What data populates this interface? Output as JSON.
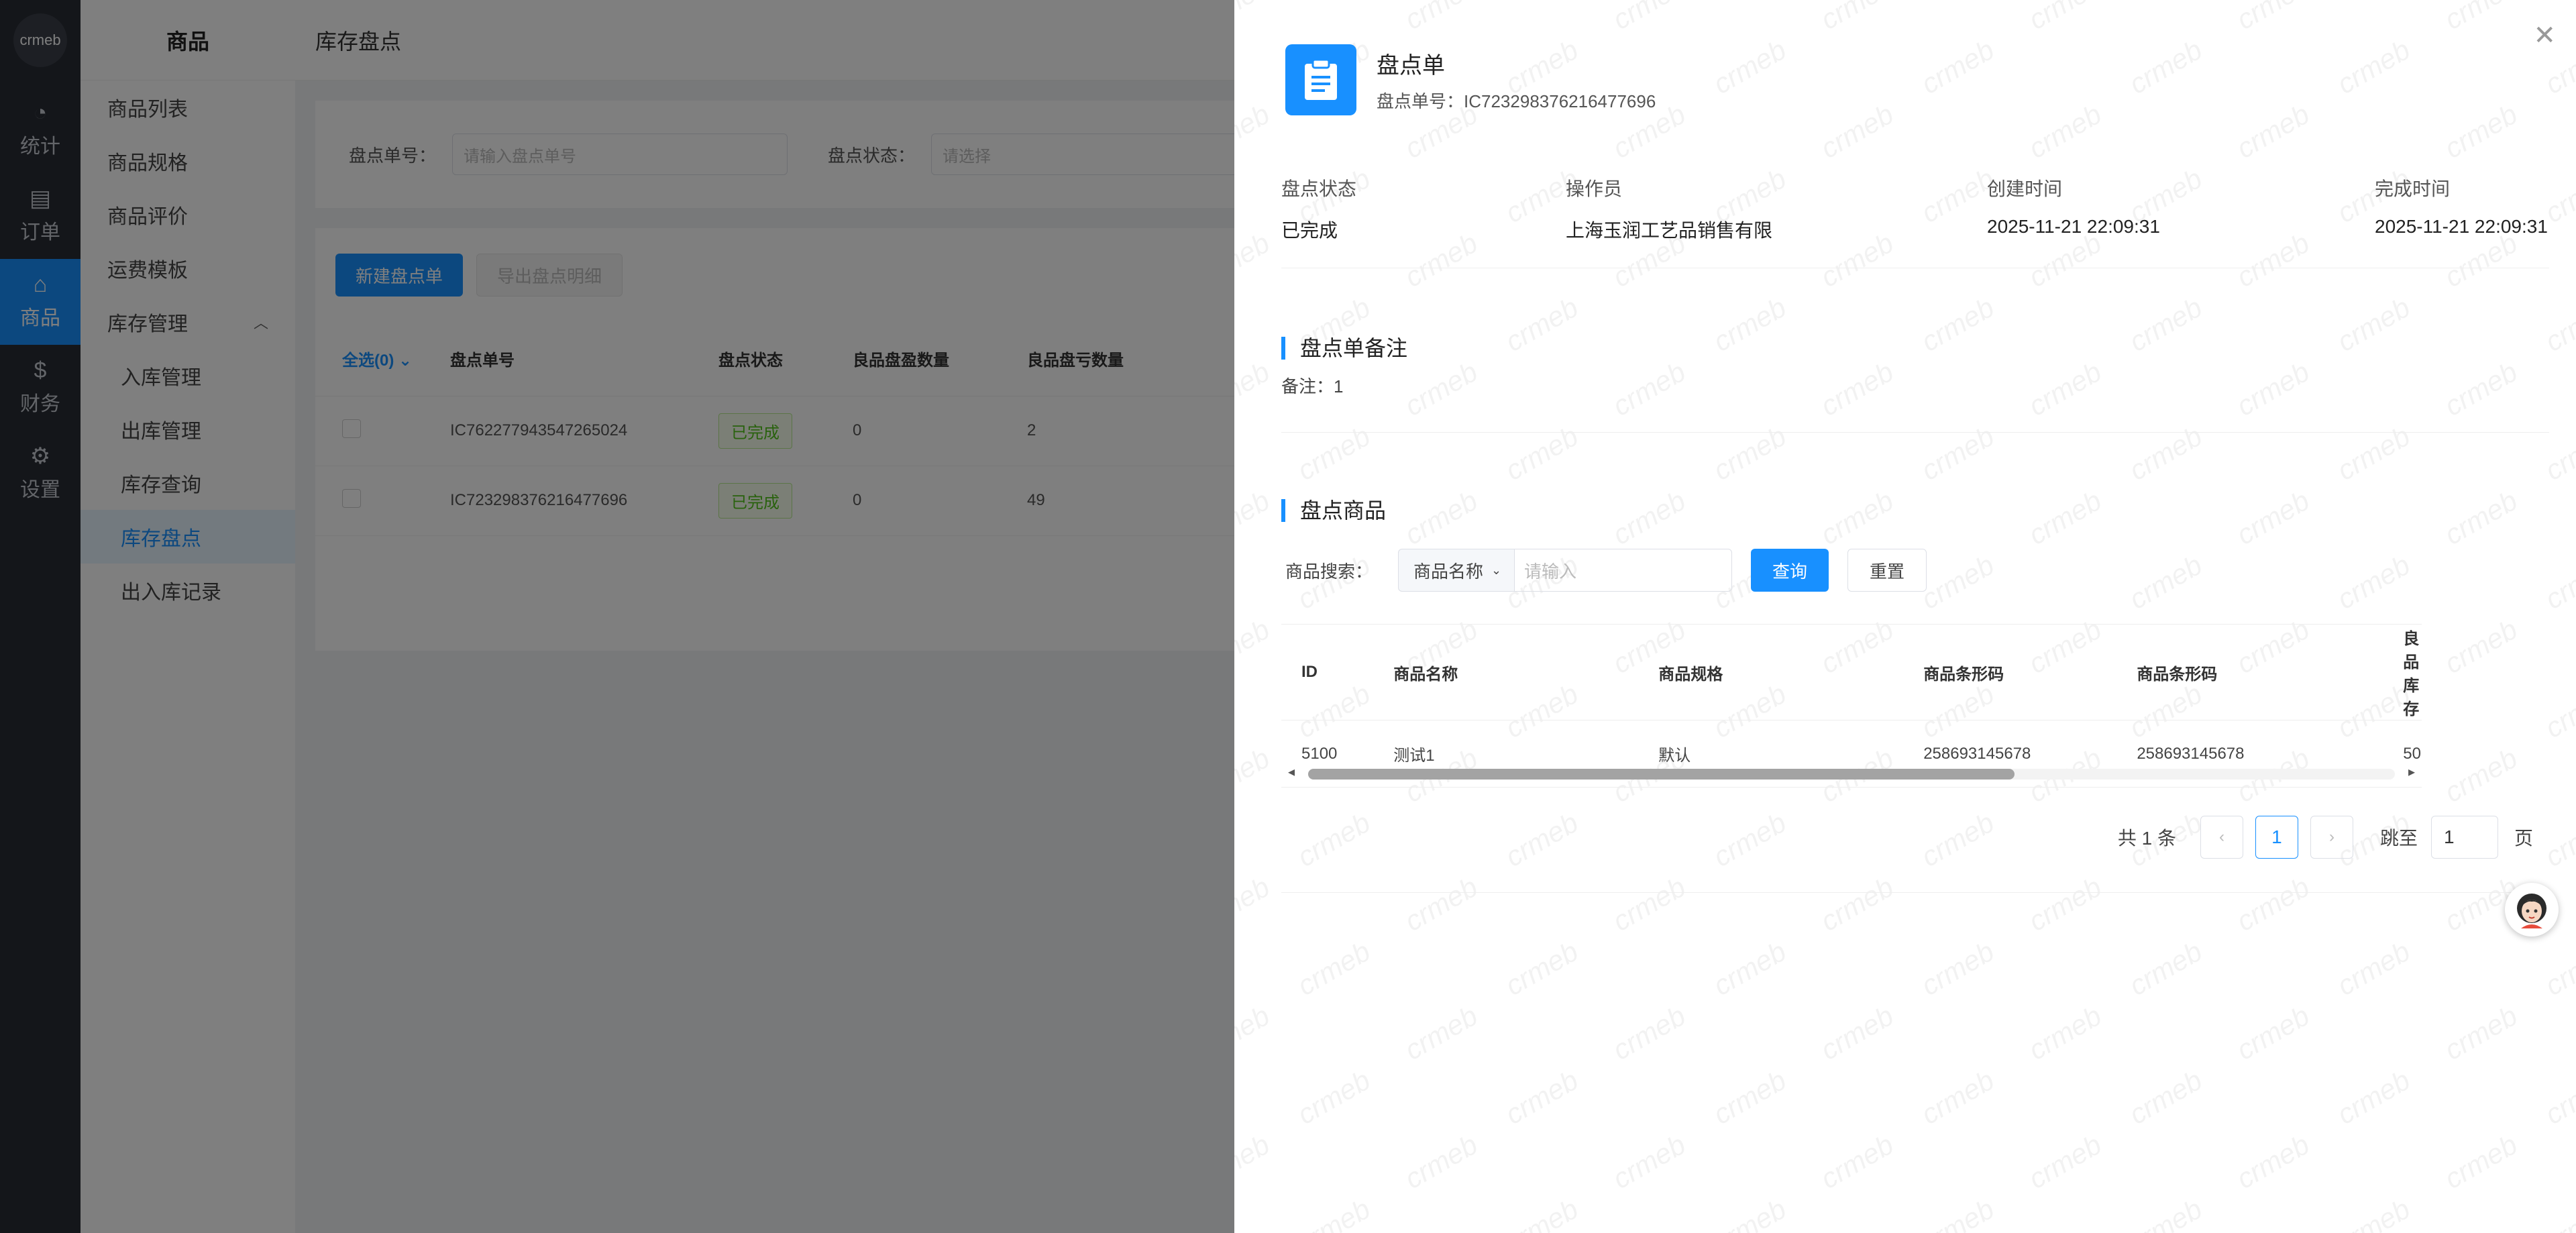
{
  "brand": {
    "logo_text": "crmeb"
  },
  "rail": [
    {
      "label": "统计",
      "icon": "pie-chart-icon",
      "glyph": "◔"
    },
    {
      "label": "订单",
      "icon": "document-icon",
      "glyph": "▤"
    },
    {
      "label": "商品",
      "icon": "shopping-basket-icon",
      "glyph": "⌂",
      "active": true
    },
    {
      "label": "财务",
      "icon": "dollar-icon",
      "glyph": "$"
    },
    {
      "label": "设置",
      "icon": "gear-icon",
      "glyph": "⚙"
    }
  ],
  "submenu": {
    "title": "商品",
    "items": [
      "商品列表",
      "商品规格",
      "商品评价",
      "运费模板",
      "库存管理"
    ],
    "children": [
      "入库管理",
      "出库管理",
      "库存查询",
      "库存盘点",
      "出入库记录"
    ],
    "active_child": "库存盘点"
  },
  "main": {
    "breadcrumb": "库存盘点",
    "filter": {
      "no_label": "盘点单号：",
      "no_placeholder": "请输入盘点单号",
      "status_label": "盘点状态：",
      "status_placeholder": "请选择"
    },
    "buttons": {
      "new": "新建盘点单",
      "export": "导出盘点明细"
    },
    "table": {
      "select_all": "全选(0)",
      "headers": [
        "盘点单号",
        "盘点状态",
        "良品盘盈数量",
        "良品盘亏数量"
      ],
      "rows": [
        {
          "no": "IC762277943547265024",
          "status": "已完成",
          "gain": "0",
          "loss": "2"
        },
        {
          "no": "IC723298376216477696",
          "status": "已完成",
          "gain": "0",
          "loss": "49"
        }
      ]
    }
  },
  "drawer": {
    "title": "盘点单",
    "order_no_label": "盘点单号：",
    "order_no": "IC723298376216477696",
    "info": [
      {
        "label": "盘点状态",
        "value": "已完成"
      },
      {
        "label": "操作员",
        "value": "上海玉润工艺品销售有限"
      },
      {
        "label": "创建时间",
        "value": "2025-11-21 22:09:31"
      },
      {
        "label": "完成时间",
        "value": "2025-11-21 22:09:31"
      }
    ],
    "remark_title": "盘点单备注",
    "remark_label": "备注：",
    "remark_value": "1",
    "goods_title": "盘点商品",
    "search": {
      "label": "商品搜索：",
      "field": "商品名称",
      "placeholder": "请输入",
      "query": "查询",
      "reset": "重置"
    },
    "goods_table": {
      "headers": [
        "ID",
        "商品名称",
        "商品规格",
        "商品条形码",
        "商品条形码",
        "良品库存"
      ],
      "rows": [
        [
          "5100",
          "测试1",
          "默认",
          "258693145678",
          "258693145678",
          "50"
        ]
      ]
    },
    "scroll_fraction": 0.65,
    "pager": {
      "total": "共 1 条",
      "current": "1",
      "jump_label": "跳至",
      "jump_value": "1",
      "page_unit": "页"
    }
  }
}
